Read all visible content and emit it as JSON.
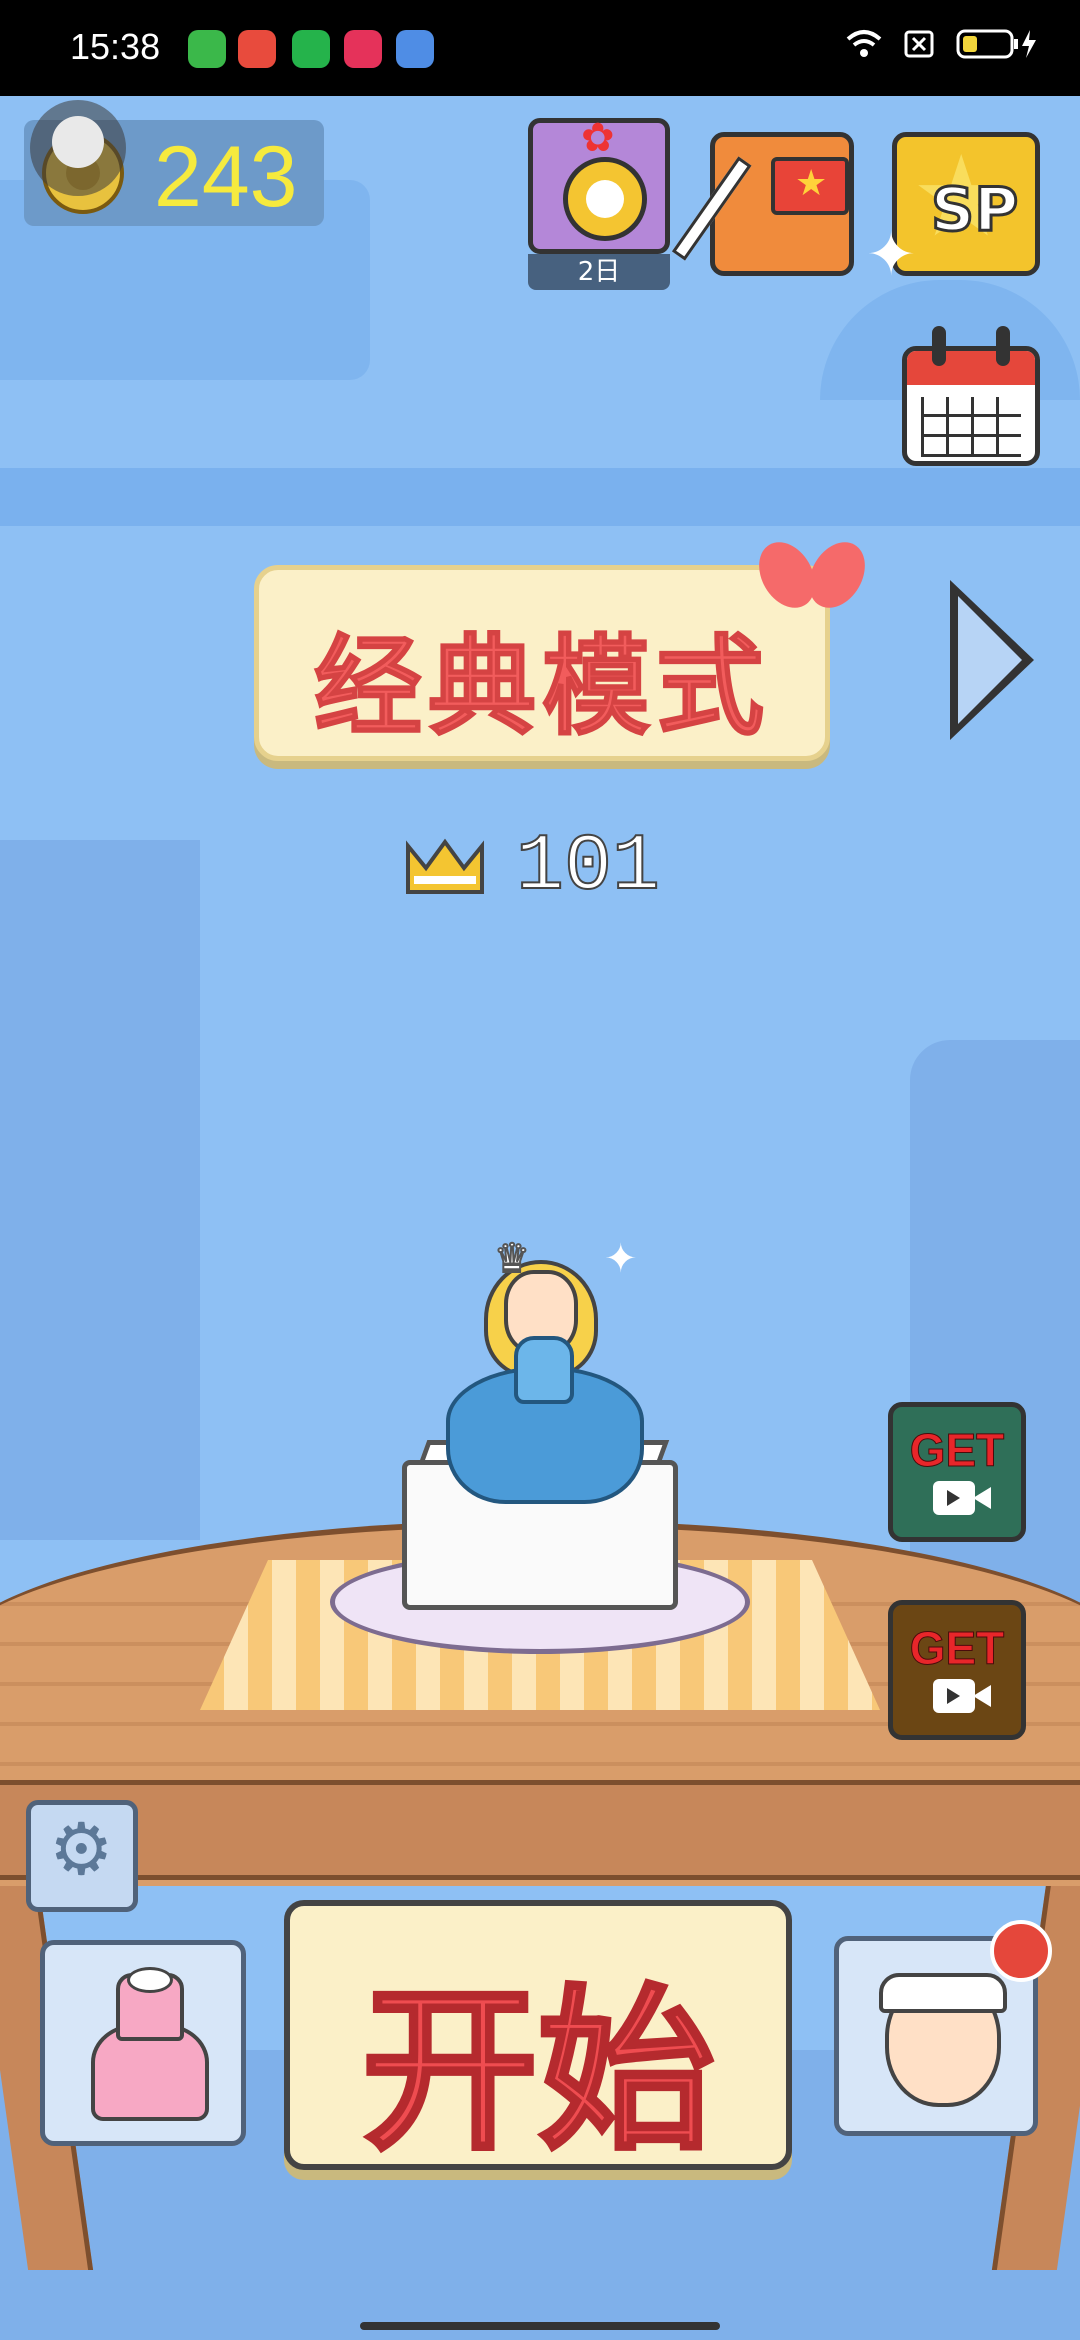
{
  "status_bar": {
    "time": "15:38",
    "app_icons": [
      "green-app-icon",
      "red-play-icon",
      "green-ring-icon",
      "red-music-icon",
      "blue-app-icon"
    ],
    "system_icons": [
      "wifi-icon",
      "sim-off-icon",
      "battery-charging-icon"
    ]
  },
  "hud": {
    "coins": "243",
    "gift_label": "2日"
  },
  "mode": {
    "title": "经典模式",
    "best_score": "101"
  },
  "buttons": {
    "get_label_1": "GET",
    "get_label_2": "GET",
    "start_label": "开始",
    "sp_label": "SP"
  },
  "colors": {
    "background": "#8ec0f4",
    "start_text": "#ef4c50",
    "coin_text": "#f6ea3e",
    "get_green": "#2f6f58",
    "get_brown": "#6b4614"
  }
}
